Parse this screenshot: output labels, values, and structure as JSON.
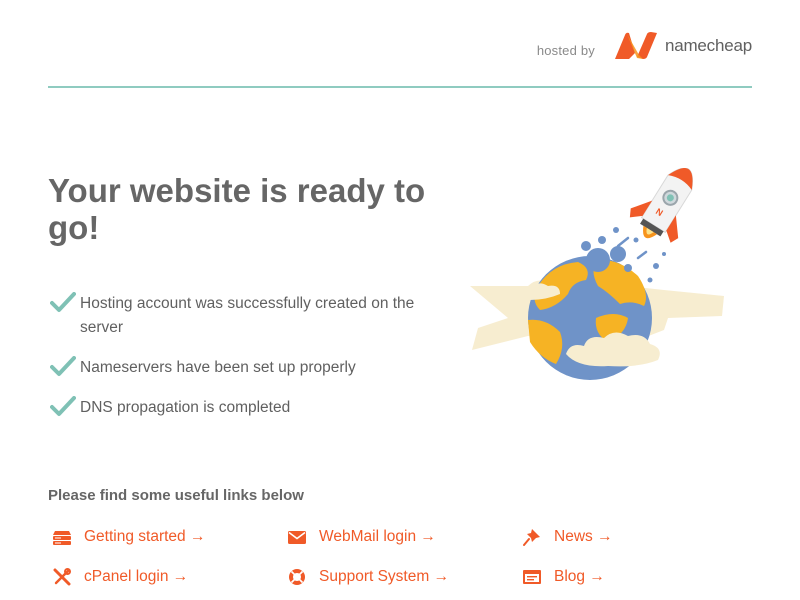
{
  "header": {
    "hosted_by": "hosted by",
    "brand_name": "namecheap",
    "brand_color": "#f05a28"
  },
  "main": {
    "headline": "Your website is ready to go!",
    "checks": [
      "Hosting account was successfully created on the server",
      "Nameservers have been set up properly",
      "DNS propagation is completed"
    ],
    "check_color": "#7fc1b5"
  },
  "links_section": {
    "title": "Please find some useful links below",
    "link_color": "#f05a28",
    "links": [
      {
        "label": "Getting started →",
        "icon": "server-icon"
      },
      {
        "label": "WebMail login →",
        "icon": "envelope-icon"
      },
      {
        "label": "News →",
        "icon": "pushpin-icon"
      },
      {
        "label": "cPanel login →",
        "icon": "tools-icon"
      },
      {
        "label": "Support System →",
        "icon": "lifebuoy-icon"
      },
      {
        "label": "Blog →",
        "icon": "browser-window-icon"
      }
    ]
  },
  "illustration": {
    "name": "rocket-launching-from-globe",
    "globe_color": "#6f93c8",
    "land_color": "#f6b324",
    "cloud_color": "#f7edd0",
    "rocket_accent": "#f05a28"
  }
}
